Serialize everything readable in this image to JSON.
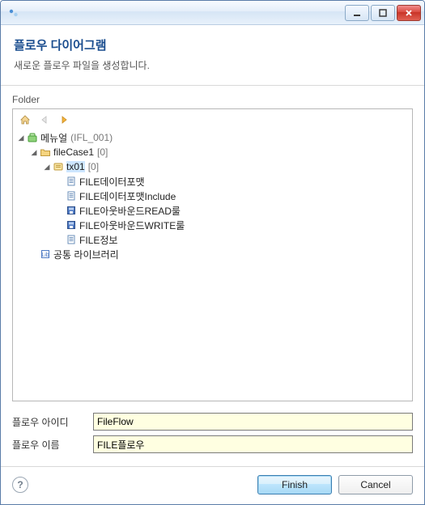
{
  "titlebar": {
    "icon_title": ""
  },
  "header": {
    "title": "플로우 다이어그램",
    "subtitle": "새로운 플로우 파일을 생성합니다."
  },
  "folder_label": "Folder",
  "tree": {
    "menu_label": "메뉴얼",
    "menu_code": "(IFL_001)",
    "fileCase_label": "fileCase1",
    "fileCase_count": "[0]",
    "tx_label": "tx01",
    "tx_count": "[0]",
    "items": [
      "FILE데이터포맷",
      "FILE데이터포맷Include",
      "FILE아웃바운드READ룰",
      "FILE아웃바운드WRITE룰",
      "FILE정보"
    ],
    "lib_label": "공통 라이브러리"
  },
  "fields": {
    "id_label": "플로우 아이디",
    "id_value": "FileFlow",
    "name_label": "플로우 이름",
    "name_value": "FILE플로우"
  },
  "buttons": {
    "finish": "Finish",
    "cancel": "Cancel"
  }
}
